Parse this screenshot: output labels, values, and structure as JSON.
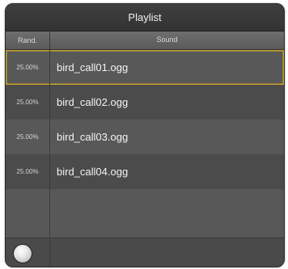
{
  "window": {
    "title": "Playlist"
  },
  "columns": {
    "rand": "Rand.",
    "sound": "Sound"
  },
  "rows": [
    {
      "rand": "25.00%",
      "sound": "bird_call01.ogg",
      "selected": true
    },
    {
      "rand": "25.00%",
      "sound": "bird_call02.ogg",
      "selected": false
    },
    {
      "rand": "25.00%",
      "sound": "bird_call03.ogg",
      "selected": false
    },
    {
      "rand": "25.00%",
      "sound": "bird_call04.ogg",
      "selected": false
    }
  ],
  "footer": {
    "play_icon": "circle-play-icon"
  },
  "colors": {
    "selection_border": "#c9a52a",
    "panel_bg": "#4e4e4e"
  }
}
